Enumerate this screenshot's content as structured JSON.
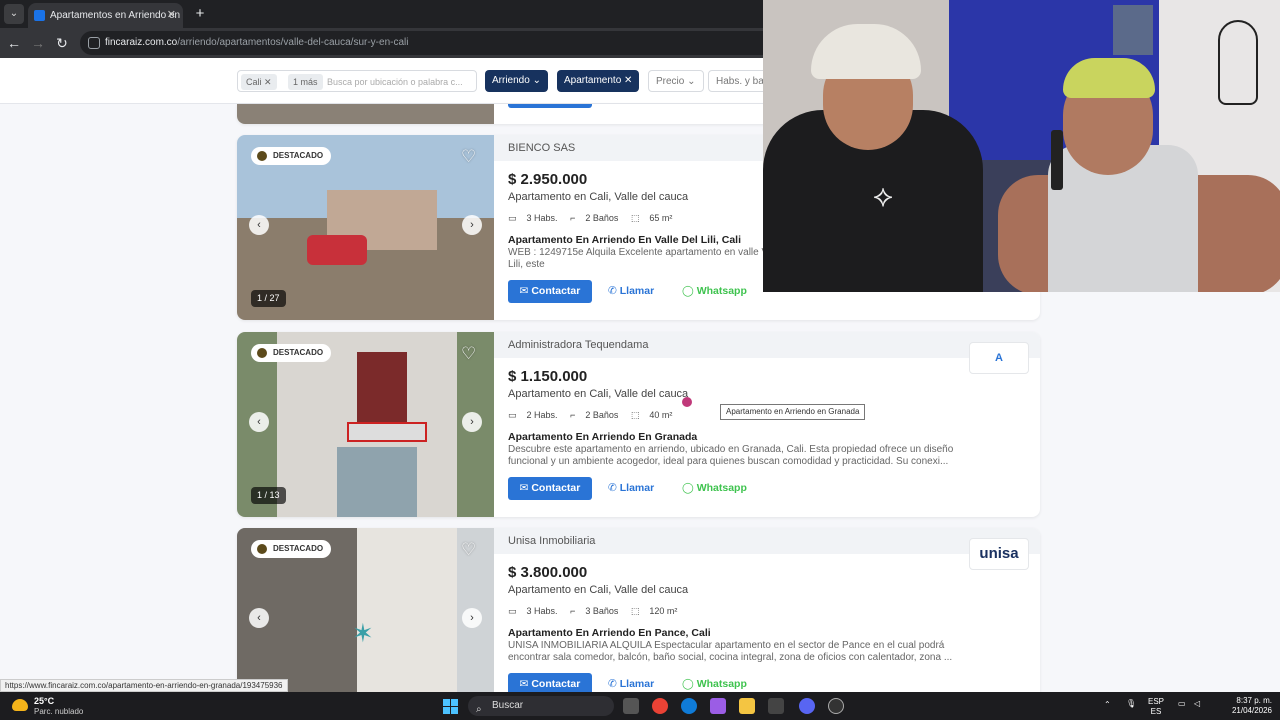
{
  "browser": {
    "tab_title": "Apartamentos en Arriendo en S",
    "url_host": "fincaraiz.com.co",
    "url_path": "/arriendo/apartamentos/valle-del-cauca/sur-y-en-cali"
  },
  "filters": {
    "chips": [
      "Cali",
      "1 más"
    ],
    "search_placeholder": "Busca por ubicación o palabra c...",
    "operation": "Arriendo",
    "property_type": "Apartamento",
    "price": "Precio",
    "rooms": "Habs. y ban"
  },
  "listings": [
    {
      "agency": "BIENCO SAS",
      "badge": "DESTACADO",
      "price": "$ 2.950.000",
      "type": "Apartamento en Cali, Valle del cauca",
      "rooms": "3 Habs.",
      "baths": "2 Baños",
      "area": "65 m²",
      "title": "Apartamento En Arriendo En Valle Del Lili, Cali",
      "desc": "WEB : 1249715e Alquila Excelente apartamento en valle Valle del Lili, Makro, Jardín plaza CR. Patios del Lili, este",
      "photo_counter": "1 / 27",
      "logo": ""
    },
    {
      "agency": "Administradora Tequendama",
      "badge": "DESTACADO",
      "price": "$ 1.150.000",
      "type": "Apartamento en Cali, Valle del cauca",
      "rooms": "2 Habs.",
      "baths": "2 Baños",
      "area": "40 m²",
      "title": "Apartamento En Arriendo En Granada",
      "desc": "Descubre este apartamento en arriendo, ubicado en Granada, Cali. Esta propiedad ofrece un diseño funcional y un ambiente acogedor, ideal para quienes buscan comodidad y practicidad. Su conexi...",
      "photo_counter": "1 / 13",
      "logo": "A"
    },
    {
      "agency": "Unisa Inmobiliaria",
      "badge": "DESTACADO",
      "price": "$ 3.800.000",
      "type": "Apartamento en Cali, Valle del cauca",
      "rooms": "3 Habs.",
      "baths": "3 Baños",
      "area": "120 m²",
      "title": "Apartamento En Arriendo En Pance, Cali",
      "desc": "UNISA INMOBILIARIA ALQUILA Espectacular apartamento en el sector de Pance en el cual podrá encontrar sala comedor, balcón, baño social, cocina integral, zona de oficios con calentador, zona ...",
      "photo_counter": "",
      "logo": "unisa"
    }
  ],
  "actions": {
    "contact": "Contactar",
    "call": "Llamar",
    "whatsapp": "Whatsapp"
  },
  "tooltip": "Apartamento en Arriendo en Granada",
  "status_url": "https://www.fincaraiz.com.co/apartamento-en-arriendo-en-granada/193475936",
  "taskbar": {
    "temp": "25°C",
    "weather": "Parc. nublado",
    "search": "Buscar",
    "lang_top": "ESP",
    "lang_bottom": "ES",
    "time": "8:37 p. m.",
    "date": "21/04/2026"
  },
  "colors": {
    "primary": "#2a74d6",
    "whatsapp": "#3fc34f",
    "filter_dark": "#17325e"
  }
}
